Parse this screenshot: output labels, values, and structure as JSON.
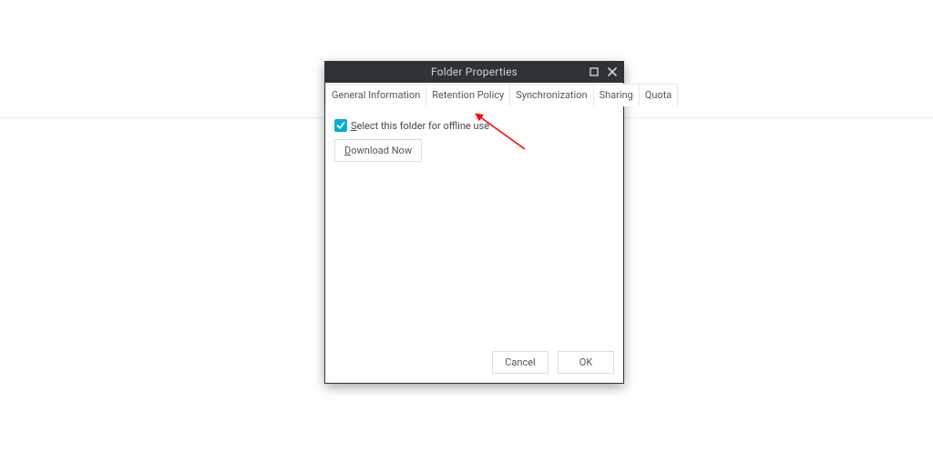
{
  "accent": "#00b0cc",
  "window": {
    "title": "Folder Properties"
  },
  "tabs": [
    {
      "label": "General Information",
      "active": false
    },
    {
      "label": "Retention Policy",
      "active": false
    },
    {
      "label": "Synchronization",
      "active": true
    },
    {
      "label": "Sharing",
      "active": false
    },
    {
      "label": "Quota",
      "active": false
    }
  ],
  "sync": {
    "checkbox_checked": true,
    "checkbox_label_pre_mn": "",
    "checkbox_label_mn": "S",
    "checkbox_label_post_mn": "elect this folder for offline use",
    "download_label_mn": "D",
    "download_label_post_mn": "ownload Now"
  },
  "buttons": {
    "cancel": "Cancel",
    "ok": "OK"
  }
}
